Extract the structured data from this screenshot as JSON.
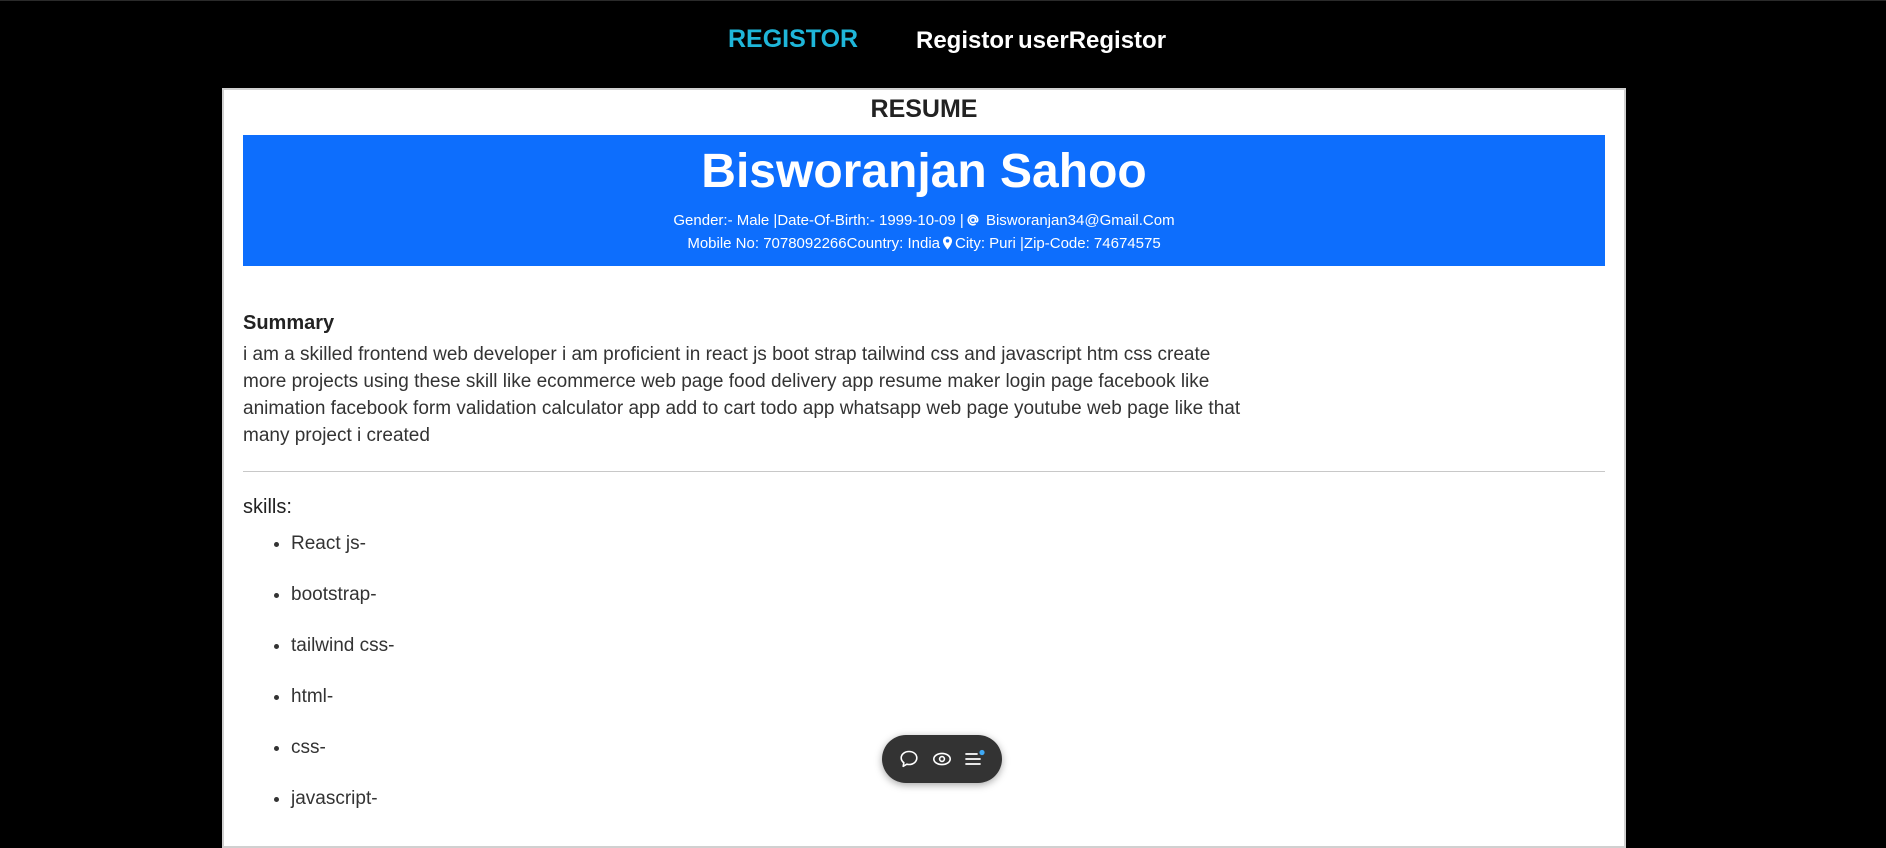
{
  "nav": {
    "brand": "REGISTOR",
    "links": [
      "Registor",
      "userRegistor"
    ]
  },
  "resume": {
    "heading": "RESUME",
    "name": "Bisworanjan Sahoo",
    "info_line_1_left": "Gender:- Male |Date-Of-Birth:- 1999-10-09 |",
    "email": "Bisworanjan34@Gmail.Com",
    "info_line_2_left": "Mobile No: 7078092266Country: India",
    "info_line_2_right": "City: Puri |Zip-Code: 74674575",
    "summary_title": "Summary",
    "summary_text": "i am a skilled frontend web developer i am proficient in react js boot strap tailwind css and javascript htm css create more projects using these skill like ecommerce web page food delivery app resume maker login page facebook like animation facebook form validation calculator app add to cart todo app whatsapp web page youtube web page like that many project i created",
    "skills_title": "skills:",
    "skills": [
      "React js-",
      "bootstrap-",
      "tailwind css-",
      "html-",
      "css-",
      "javascript-"
    ]
  },
  "toolbar": {
    "icons": [
      "chat-icon",
      "eye-icon",
      "list-icon"
    ],
    "badge_color": "#3fa9f5"
  },
  "colors": {
    "brand": "#1fb6d9",
    "header_bg": "#0d6efd",
    "page_bg": "#000000"
  }
}
